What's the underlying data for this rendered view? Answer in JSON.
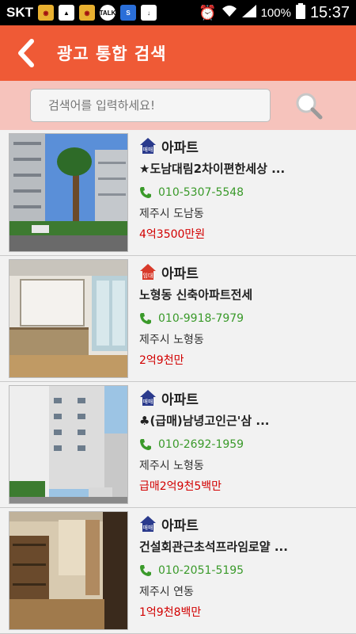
{
  "status": {
    "carrier": "SKT",
    "battery": "100%",
    "time": "15:37",
    "icons": [
      "game-icon",
      "gallery-icon",
      "game-icon",
      "talk-icon",
      "samsung-icon",
      "download-icon"
    ]
  },
  "header": {
    "title": "광고 통합 검색",
    "back_icon": "chevron-left-icon",
    "bg_color": "#ef5a36"
  },
  "search": {
    "placeholder": "검색어를 입력하세요!",
    "button_icon": "search-icon"
  },
  "listings": [
    {
      "badge": "매매",
      "badge_color": "#2a3a8c",
      "type": "아파트",
      "name": "★도남대림2차이편한세상 ...",
      "phone": "010-5307-5548",
      "location": "제주시 도남동",
      "price": "4억3500만원"
    },
    {
      "badge": "임대",
      "badge_color": "#d83a2a",
      "type": "아파트",
      "name": "노형동 신축아파트전세",
      "phone": "010-9918-7979",
      "location": "제주시 노형동",
      "price": "2억9천만"
    },
    {
      "badge": "매매",
      "badge_color": "#2a3a8c",
      "type": "아파트",
      "name": "♣(급매)남녕고인근'삼 ...",
      "phone": "010-2692-1959",
      "location": "제주시 노형동",
      "price": "급매2억9천5백만"
    },
    {
      "badge": "매매",
      "badge_color": "#2a3a8c",
      "type": "아파트",
      "name": "건설회관근초석프라임로얄 ...",
      "phone": "010-2051-5195",
      "location": "제주시 연동",
      "price": "1억9천8백만"
    }
  ]
}
